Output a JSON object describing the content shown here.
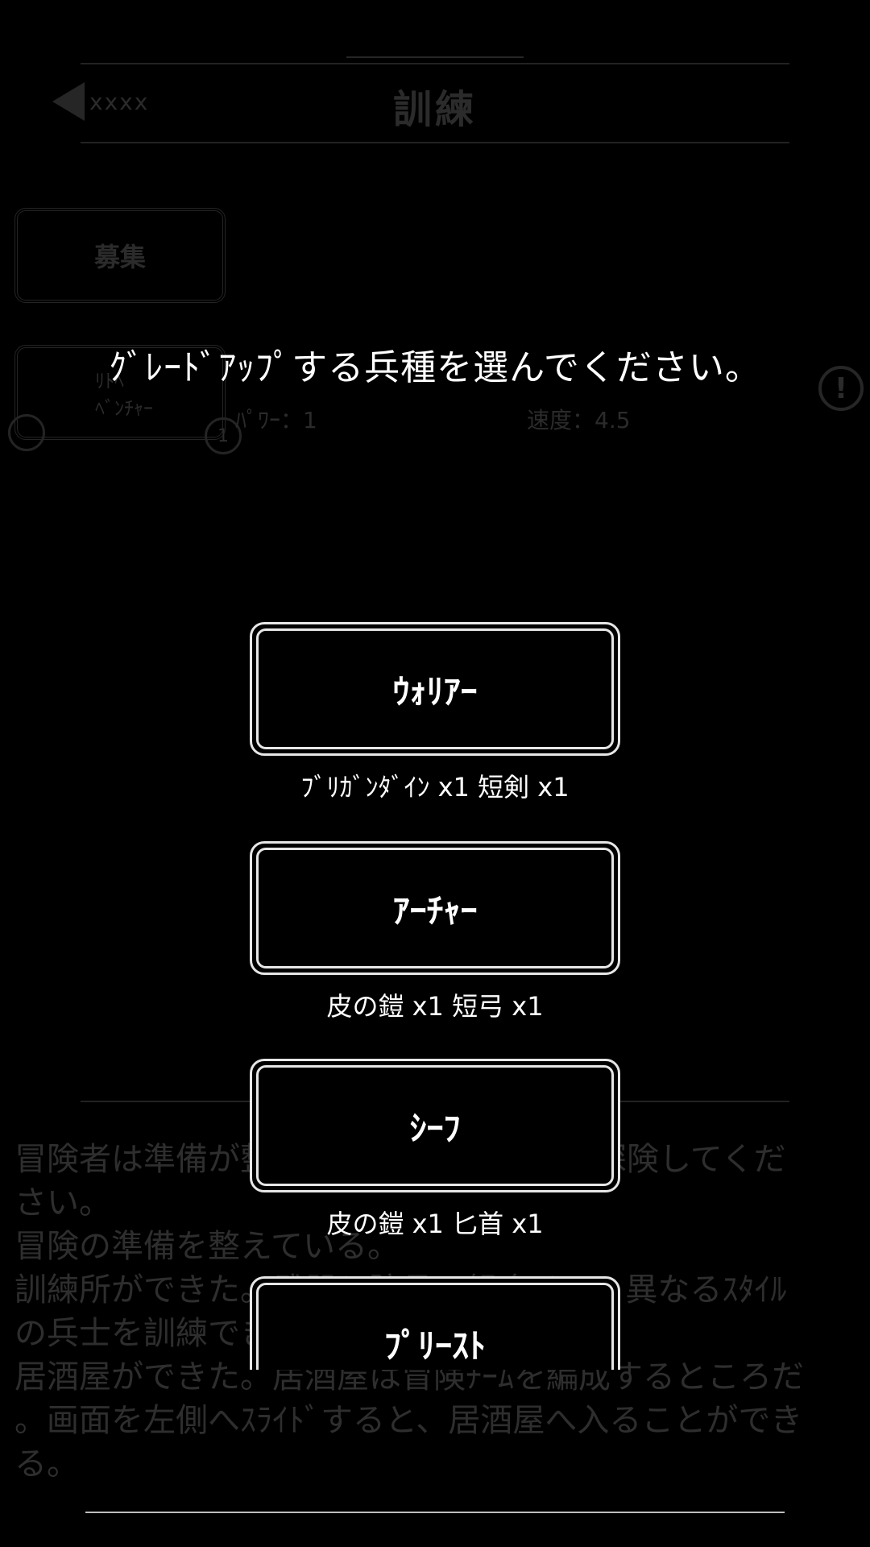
{
  "header": {
    "back_label": "xxxx",
    "title": "訓練"
  },
  "recruit_button": "募集",
  "unit_card": {
    "line1": "ﾘﾄﾍ",
    "line2": "ﾍﾞﾝﾁｬｰ",
    "left_badge": "",
    "right_badge": "1"
  },
  "stats": {
    "power": "ﾊﾟﾜｰ：1",
    "speed": "速度：4.5"
  },
  "alert_icon": "!",
  "log": [
    "冒険者は準備が整った。遠征の居酒屋へ探険してくだ",
    "さい。",
    "冒険の準備を整えている。",
    "訓練所ができた。武器と防具の組合せで、異なるｽﾀｲﾙ",
    "の兵士を訓練できる。",
    "居酒屋ができた。居酒屋は冒険ﾁｰﾑを編成するところだ",
    "。画面を左側へｽﾗｲﾄﾞすると、居酒屋へ入ることができ",
    "る。"
  ],
  "dialog": {
    "prompt": "ｸﾞﾚｰﾄﾞｱｯﾌﾟする兵種を選んでください。",
    "options": [
      {
        "label": "ｳｫﾘｱｰ",
        "cost": "ﾌﾞﾘｶﾞﾝﾀﾞｲﾝ x1 短剣 x1"
      },
      {
        "label": "ｱｰﾁｬｰ",
        "cost": "皮の鎧 x1 短弓 x1"
      },
      {
        "label": "ｼｰﾌ",
        "cost": "皮の鎧 x1 匕首 x1"
      },
      {
        "label": "ﾌﾟﾘｰｽﾄ",
        "cost": ""
      }
    ]
  }
}
